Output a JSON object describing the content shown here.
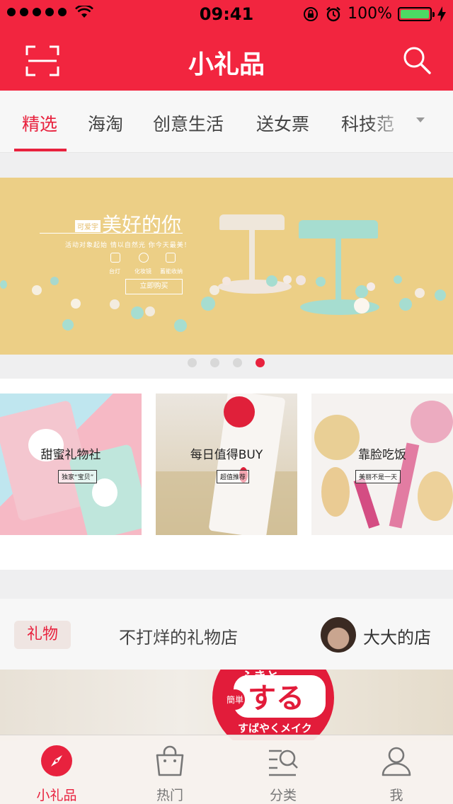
{
  "status_bar": {
    "time": "09:41",
    "battery": "100%",
    "signal_bars": 5,
    "battery_level": 1.0
  },
  "nav": {
    "title": "小礼品",
    "left_icon": "scan-icon",
    "right_icon": "search-icon"
  },
  "tabs": [
    {
      "label": "精选",
      "active": true
    },
    {
      "label": "海淘"
    },
    {
      "label": "创意生活"
    },
    {
      "label": "送女票"
    },
    {
      "label": "科技范"
    }
  ],
  "banner": {
    "tag": "可爱宇",
    "title": "美好的你",
    "subtitle": "活动对象起始   情以自然光   你今天最美！",
    "icons": [
      {
        "label": "台灯"
      },
      {
        "label": "化妆镜"
      },
      {
        "label": "蓄能收纳"
      }
    ],
    "button": "立即购买",
    "page_count": 4,
    "active_page": 4
  },
  "cards": [
    {
      "label": "甜蜜礼物社",
      "tag": "独家“宝贝”"
    },
    {
      "label": "每日值得BUY",
      "tag": "超值推荐"
    },
    {
      "label": "靠脸吃饭",
      "tag": "美丽不是一天"
    }
  ],
  "shop": {
    "badge": "礼物",
    "name": "不打烊的礼物店",
    "owner": "大大的店"
  },
  "product": {
    "text_big": "する",
    "text_top": "ふきと",
    "text_left": "簡単",
    "text_line": "すばやくメイク"
  },
  "tabbar": [
    {
      "label": "小礼品",
      "icon": "compass-icon",
      "active": true
    },
    {
      "label": "热门",
      "icon": "shopping-bag-icon"
    },
    {
      "label": "分类",
      "icon": "category-search-icon"
    },
    {
      "label": "我",
      "icon": "person-icon"
    }
  ],
  "colors": {
    "brand": "#f2253f",
    "accent": "#e8223e",
    "banner_bg": "#eccf86"
  }
}
